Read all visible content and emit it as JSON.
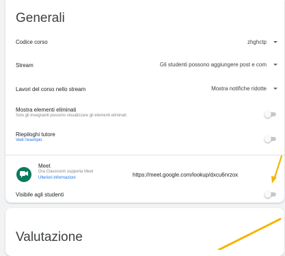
{
  "general": {
    "title": "Generali",
    "class_code": {
      "label": "Codice corso",
      "value": "zhghctp"
    },
    "stream": {
      "label": "Stream",
      "value": "Gli studenti possono aggiungere post e com"
    },
    "classwork_on_stream": {
      "label": "Lavori del corso nello stream",
      "value": "Mostra notifiche ridotte"
    },
    "show_deleted": {
      "label": "Mostra elementi eliminati",
      "description": "Solo gli insegnanti possono visualizzare gli elementi eliminati",
      "enabled": false
    },
    "guardian_summaries": {
      "label": "Riepiloghi tutore",
      "link": "Vedi l'esempio",
      "enabled": false
    }
  },
  "meet": {
    "name": "Meet",
    "subtitle": "Ora Classroom supporta Meet",
    "more_info": "Ulteriori informazioni",
    "link": "https://meet.google.com/lookup/dxcu6nrzox",
    "visible_label": "Visibile agli studenti",
    "visible": false
  },
  "grading": {
    "title": "Valutazione"
  },
  "colors": {
    "background": "#f1f3f4",
    "card": "#ffffff",
    "link": "#1a73e8",
    "meet_icon": "#0c7a5d",
    "annotation_arrow": "#f5b400"
  }
}
